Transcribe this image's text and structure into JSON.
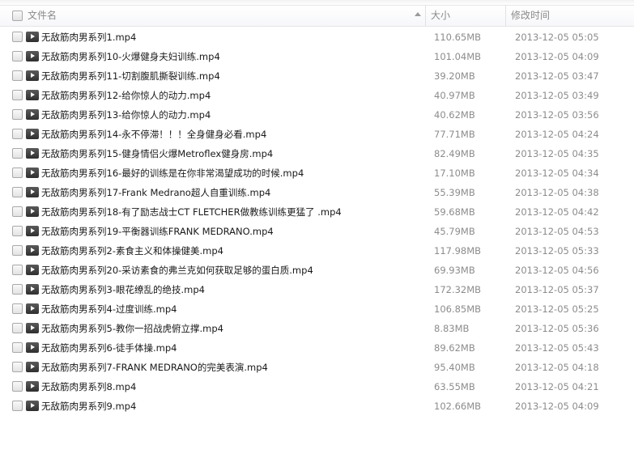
{
  "header": {
    "name_label": "文件名",
    "size_label": "大小",
    "time_label": "修改时间"
  },
  "files": [
    {
      "name": "无敌筋肉男系列1.mp4",
      "size": "110.65MB",
      "modified": "2013-12-05 05:05"
    },
    {
      "name": "无敌筋肉男系列10-火爆健身夫妇训练.mp4",
      "size": "101.04MB",
      "modified": "2013-12-05 04:09"
    },
    {
      "name": "无敌筋肉男系列11-切割腹肌撕裂训练.mp4",
      "size": "39.20MB",
      "modified": "2013-12-05 03:47"
    },
    {
      "name": "无敌筋肉男系列12-给你惊人的动力.mp4",
      "size": "40.97MB",
      "modified": "2013-12-05 03:49"
    },
    {
      "name": "无敌筋肉男系列13-给你惊人的动力.mp4",
      "size": "40.62MB",
      "modified": "2013-12-05 03:56"
    },
    {
      "name": "无敌筋肉男系列14-永不停滞！！！全身健身必看.mp4",
      "size": "77.71MB",
      "modified": "2013-12-05 04:24"
    },
    {
      "name": "无敌筋肉男系列15-健身情侣火爆Metroflex健身房.mp4",
      "size": "82.49MB",
      "modified": "2013-12-05 04:35"
    },
    {
      "name": "无敌筋肉男系列16-最好的训练是在你非常渴望成功的时候.mp4",
      "size": "17.10MB",
      "modified": "2013-12-05 04:34"
    },
    {
      "name": "无敌筋肉男系列17-Frank Medrano超人自重训练.mp4",
      "size": "55.39MB",
      "modified": "2013-12-05 04:38"
    },
    {
      "name": "无敌筋肉男系列18-有了励志战士CT FLETCHER做教练训练更猛了 .mp4",
      "size": "59.68MB",
      "modified": "2013-12-05 04:42"
    },
    {
      "name": "无敌筋肉男系列19-平衡器训练FRANK MEDRANO.mp4",
      "size": "45.79MB",
      "modified": "2013-12-05 04:53"
    },
    {
      "name": "无敌筋肉男系列2-素食主义和体操健美.mp4",
      "size": "117.98MB",
      "modified": "2013-12-05 05:33"
    },
    {
      "name": "无敌筋肉男系列20-采访素食的弗兰克如何获取足够的蛋白质.mp4",
      "size": "69.93MB",
      "modified": "2013-12-05 04:56"
    },
    {
      "name": "无敌筋肉男系列3-眼花缭乱的绝技.mp4",
      "size": "172.32MB",
      "modified": "2013-12-05 05:37"
    },
    {
      "name": "无敌筋肉男系列4-过度训练.mp4",
      "size": "106.85MB",
      "modified": "2013-12-05 05:25"
    },
    {
      "name": "无敌筋肉男系列5-教你一招战虎俯立撑.mp4",
      "size": "8.83MB",
      "modified": "2013-12-05 05:36"
    },
    {
      "name": "无敌筋肉男系列6-徒手体操.mp4",
      "size": "89.62MB",
      "modified": "2013-12-05 05:43"
    },
    {
      "name": "无敌筋肉男系列7-FRANK MEDRANO的完美表演.mp4",
      "size": "95.40MB",
      "modified": "2013-12-05 04:18"
    },
    {
      "name": "无敌筋肉男系列8.mp4",
      "size": "63.55MB",
      "modified": "2013-12-05 04:21"
    },
    {
      "name": "无敌筋肉男系列9.mp4",
      "size": "102.66MB",
      "modified": "2013-12-05 04:09"
    }
  ]
}
